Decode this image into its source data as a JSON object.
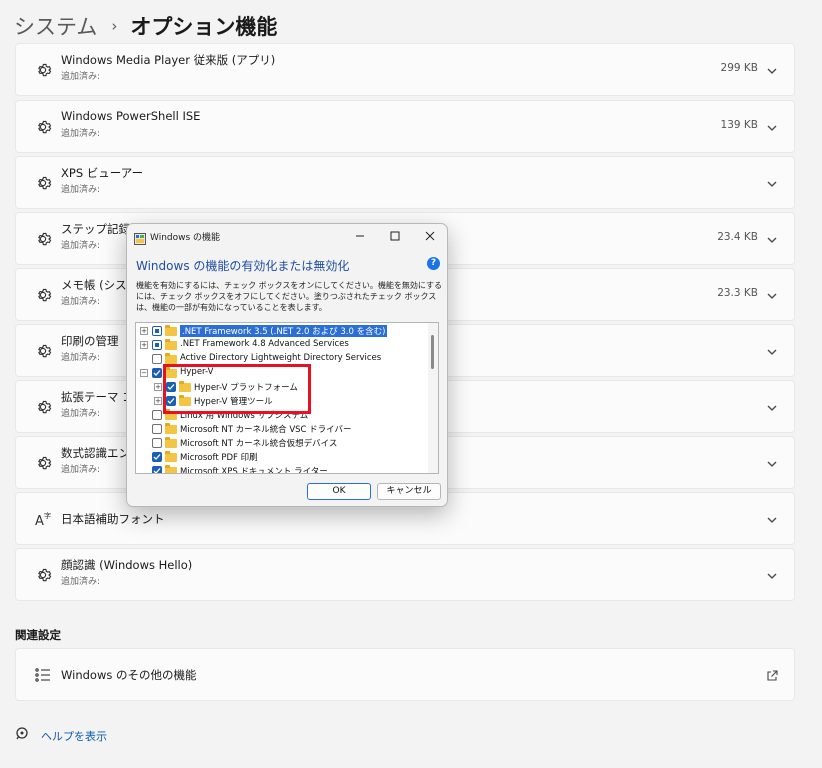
{
  "breadcrumb": {
    "parent": "システム",
    "separator": "›",
    "current": "オプション機能"
  },
  "features": [
    {
      "title": "Windows Media Player 従来版 (アプリ)",
      "sub": "追加済み:",
      "size": "299 KB",
      "icon": "gear-icon"
    },
    {
      "title": "Windows PowerShell ISE",
      "sub": "追加済み:",
      "size": "139 KB",
      "icon": "gear-icon"
    },
    {
      "title": "XPS ビューアー",
      "sub": "追加済み:",
      "size": "",
      "icon": "gear-icon"
    },
    {
      "title": "ステップ記録ツ",
      "sub": "追加済み:",
      "size": "23.4 KB",
      "icon": "gear-icon"
    },
    {
      "title": "メモ帳 (システム",
      "sub": "追加済み:",
      "size": "23.3 KB",
      "icon": "gear-icon"
    },
    {
      "title": "印刷の管理",
      "sub": "追加済み:",
      "size": "",
      "icon": "gear-icon"
    },
    {
      "title": "拡張テーマ コン",
      "sub": "追加済み:",
      "size": "",
      "icon": "gear-icon"
    },
    {
      "title": "数式認識エンジ",
      "sub": "追加済み:",
      "size": "",
      "icon": "gear-icon"
    },
    {
      "title": "日本語補助フォント",
      "sub": "",
      "size": "",
      "icon": "font-icon"
    },
    {
      "title": "顔認識 (Windows Hello)",
      "sub": "追加済み:",
      "size": "",
      "icon": "gear-icon"
    }
  ],
  "related": {
    "heading": "関連設定",
    "item_label": "Windows のその他の機能"
  },
  "help": {
    "label": "ヘルプを表示"
  },
  "dialog": {
    "title": "Windows の機能",
    "heading": "Windows の機能の有効化または無効化",
    "description": "機能を有効にするには、チェック ボックスをオンにしてください。機能を無効にするには、チェック ボックスをオフにしてください。塗りつぶされたチェック ボックスは、機能の一部が有効になっていることを表します。",
    "tree": [
      {
        "label": ".NET Framework 3.5 (.NET 2.0 および 3.0 を含む)",
        "state": "partial",
        "expander": "+",
        "level": 0,
        "selected": true
      },
      {
        "label": ".NET Framework 4.8 Advanced Services",
        "state": "partial",
        "expander": "+",
        "level": 0,
        "selected": false
      },
      {
        "label": "Active Directory Lightweight Directory Services",
        "state": "unchecked",
        "expander": "",
        "level": 0,
        "selected": false
      },
      {
        "label": "Hyper-V",
        "state": "checked",
        "expander": "−",
        "level": 0,
        "selected": false
      },
      {
        "label": "Hyper-V プラットフォーム",
        "state": "checked",
        "expander": "+",
        "level": 1,
        "selected": false
      },
      {
        "label": "Hyper-V 管理ツール",
        "state": "checked",
        "expander": "+",
        "level": 1,
        "selected": false
      },
      {
        "label": "Linux 用 Windows サブシステム",
        "state": "unchecked",
        "expander": "",
        "level": 0,
        "selected": false
      },
      {
        "label": "Microsoft NT カーネル統合 VSC ドライバー",
        "state": "unchecked",
        "expander": "",
        "level": 0,
        "selected": false
      },
      {
        "label": "Microsoft NT カーネル統合仮想デバイス",
        "state": "unchecked",
        "expander": "",
        "level": 0,
        "selected": false
      },
      {
        "label": "Microsoft PDF 印刷",
        "state": "checked",
        "expander": "",
        "level": 0,
        "selected": false
      },
      {
        "label": "Microsoft XPS ドキュメント ライター",
        "state": "checked",
        "expander": "",
        "level": 0,
        "selected": false
      }
    ],
    "ok": "OK",
    "cancel": "キャンセル",
    "help_glyph": "?"
  },
  "colors": {
    "accent": "#1a5fb4",
    "highlight": "#e81123",
    "link": "#0b5cad"
  }
}
